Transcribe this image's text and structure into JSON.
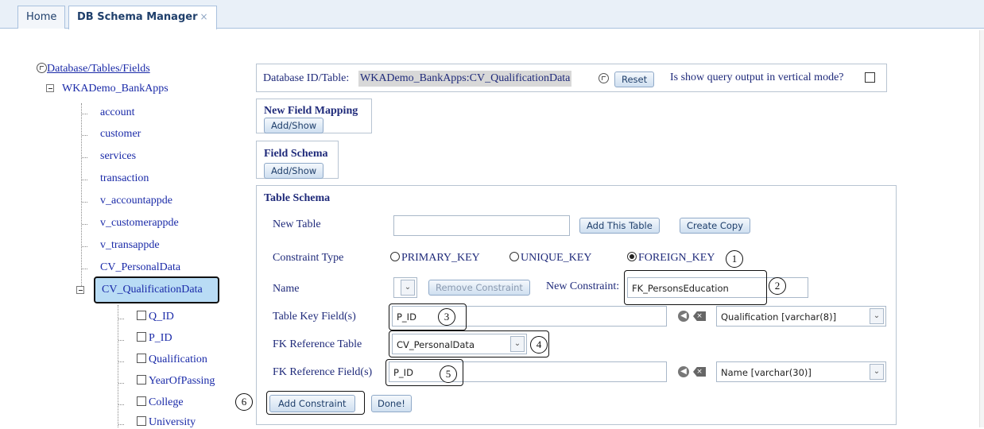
{
  "tabs": [
    {
      "label": "Home"
    },
    {
      "label": "DB Schema Manager",
      "close": "×"
    }
  ],
  "tree": {
    "root_label": "Database/Tables/Fields",
    "database": "WKADemo_BankApps",
    "tables": [
      "account",
      "customer",
      "services",
      "transaction",
      "v_accountappde",
      "v_customerappde",
      "v_transappde",
      "CV_PersonalData"
    ],
    "selected_table": "CV_QualificationData",
    "fields": [
      "Q_ID",
      "P_ID",
      "Qualification",
      "YearOfPassing",
      "College",
      "University"
    ]
  },
  "header": {
    "label": "Database ID/Table:",
    "value": "WKADemo_BankApps:CV_QualificationData",
    "reset_label": "Reset",
    "vertical_mode_label": "Is show query output in vertical mode?"
  },
  "new_field_mapping": {
    "title": "New Field Mapping",
    "button": "Add/Show"
  },
  "field_schema": {
    "title": "Field Schema",
    "button": "Add/Show"
  },
  "table_schema": {
    "title": "Table Schema",
    "new_table_label": "New Table",
    "new_table_value": "",
    "add_table_button": "Add This Table",
    "create_copy_button": "Create Copy",
    "constraint_type_label": "Constraint Type",
    "constraint_options": [
      "PRIMARY_KEY",
      "UNIQUE_KEY",
      "FOREIGN_KEY"
    ],
    "selected_constraint": "FOREIGN_KEY",
    "name_label": "Name",
    "remove_constraint_button": "Remove Constraint",
    "new_constraint_label": "New Constraint:",
    "new_constraint_value": "FK_PersonsEducation",
    "table_key_label": "Table Key Field(s)",
    "table_key_value": "P_ID",
    "table_key_select": "Qualification [varchar(8)]",
    "fk_table_label": "FK Reference Table",
    "fk_table_value": "CV_PersonalData",
    "fk_field_label": "FK Reference Field(s)",
    "fk_field_value": "P_ID",
    "fk_field_select": "Name [varchar(30)]",
    "add_constraint_button": "Add Constraint",
    "done_button": "Done!"
  },
  "callouts": [
    "1",
    "2",
    "3",
    "4",
    "5",
    "6"
  ],
  "icons": {
    "nav_back": "circle-arrow-left-icon",
    "erase": "backspace-icon",
    "refresh": "refresh-icon",
    "dropdown": "chevron-down-icon"
  },
  "colors": {
    "selected_node_bg": "#b9dcf5",
    "label_text": "#1f2a7a",
    "link_text": "#1a2aa8"
  }
}
